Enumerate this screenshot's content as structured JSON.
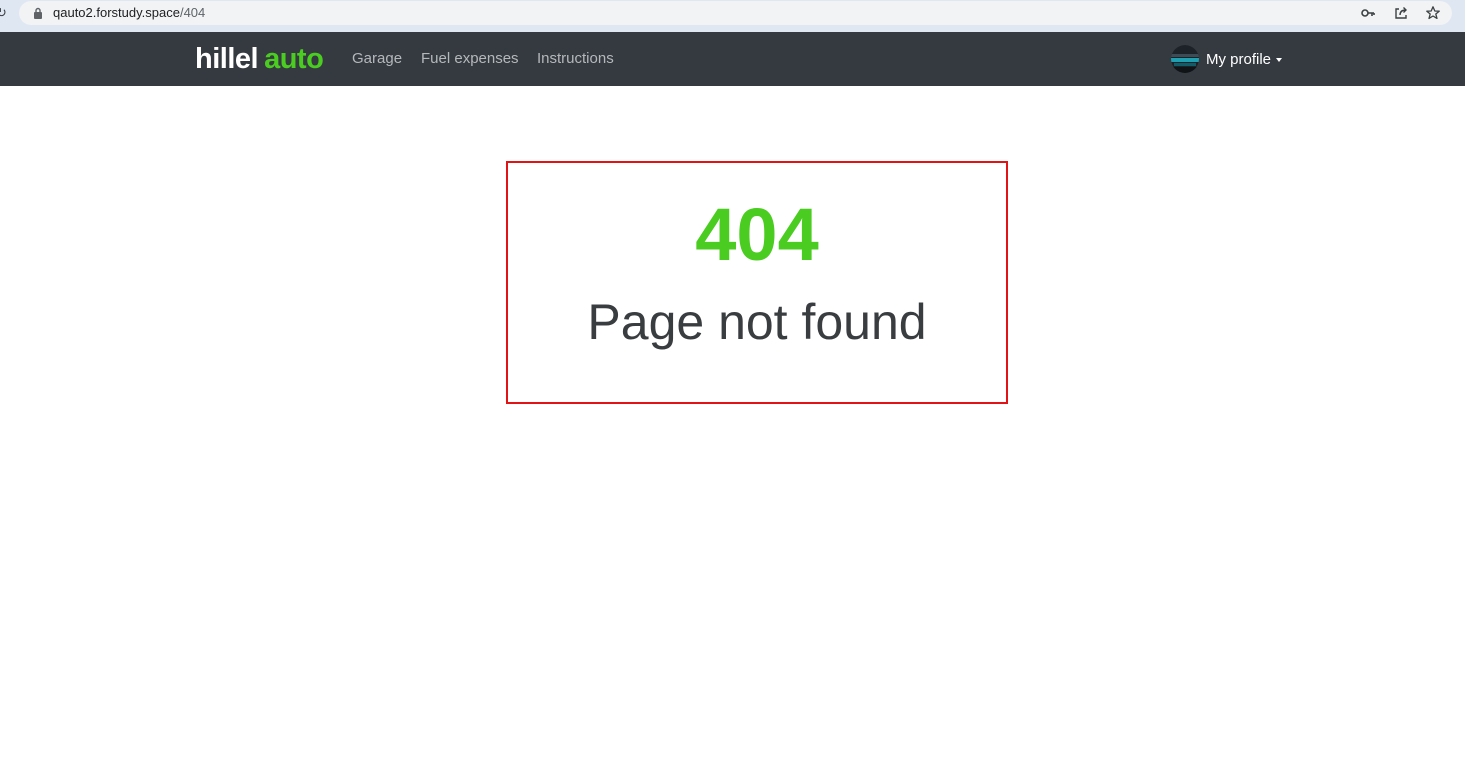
{
  "browser": {
    "url_host": "qauto2.forstudy.space",
    "url_path": "/404",
    "icons": [
      "reload-icon",
      "lock-icon",
      "key-icon",
      "share-icon",
      "star-icon"
    ]
  },
  "navbar": {
    "logo_part1": "hillel",
    "logo_part2": "auto",
    "links": [
      {
        "label": "Garage"
      },
      {
        "label": "Fuel expenses"
      },
      {
        "label": "Instructions"
      }
    ],
    "profile_label": "My profile"
  },
  "error": {
    "code": "404",
    "message": "Page not found"
  },
  "colors": {
    "navbar_bg": "#343a40",
    "brand_green": "#4bcc21",
    "highlight_border": "#e01414",
    "message_text": "#3a3d40"
  }
}
